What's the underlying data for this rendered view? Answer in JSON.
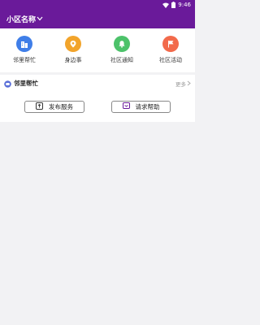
{
  "status_bar": {
    "time": "9:46"
  },
  "app_bar": {
    "community_name": "小区名称"
  },
  "quick_nav": {
    "items": [
      {
        "label": "邻里帮忙",
        "icon": "building-icon",
        "color": "#3f7ee8"
      },
      {
        "label": "身边事",
        "icon": "location-pin-icon",
        "color": "#f2a42b"
      },
      {
        "label": "社区通知",
        "icon": "bell-icon",
        "color": "#4cc26a"
      },
      {
        "label": "社区活动",
        "icon": "flag-icon",
        "color": "#f26a4b"
      }
    ]
  },
  "section": {
    "title": "邻里帮忙",
    "more_label": "更多",
    "actions": [
      {
        "label": "发布服务",
        "icon": "upload-icon"
      },
      {
        "label": "请求帮助",
        "icon": "message-icon"
      }
    ]
  },
  "colors": {
    "brand": "#6a1a9a",
    "background": "#f2f2f4"
  }
}
